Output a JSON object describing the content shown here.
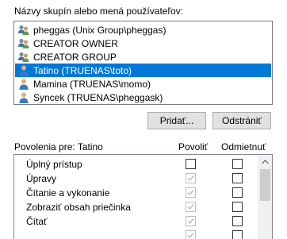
{
  "groups_label": "Názvy skupín alebo mená používateľov:",
  "users": [
    {
      "name": "pheggas (Unix Group\\pheggas)",
      "icon": "group-icon"
    },
    {
      "name": "CREATOR OWNER",
      "icon": "group-icon"
    },
    {
      "name": "CREATOR GROUP",
      "icon": "group-icon"
    },
    {
      "name": "Tatino (TRUENAS\\toto)",
      "icon": "user-icon",
      "selected": true
    },
    {
      "name": "Mamina (TRUENAS\\momo)",
      "icon": "user-icon"
    },
    {
      "name": "Syncek (TRUENAS\\pheggask)",
      "icon": "user-icon"
    }
  ],
  "buttons": {
    "add": "Pridať...",
    "remove": "Odstrániť"
  },
  "permissions_label": "Povolenia pre: Tatino",
  "columns": {
    "allow": "Povoliť",
    "deny": "Odmietnuť"
  },
  "permissions": [
    {
      "name": "Úplný prístup",
      "allow": false,
      "allow_disabled": false,
      "deny": false
    },
    {
      "name": "Úpravy",
      "allow": true,
      "allow_disabled": true,
      "deny": false
    },
    {
      "name": "Čítanie a vykonanie",
      "allow": true,
      "allow_disabled": true,
      "deny": false
    },
    {
      "name": "Zobraziť obsah priečinka",
      "allow": true,
      "allow_disabled": true,
      "deny": false
    },
    {
      "name": "Čítať",
      "allow": true,
      "allow_disabled": true,
      "deny": false
    }
  ],
  "colors": {
    "selection": "#0078d7",
    "button": "#e1e1e1"
  }
}
